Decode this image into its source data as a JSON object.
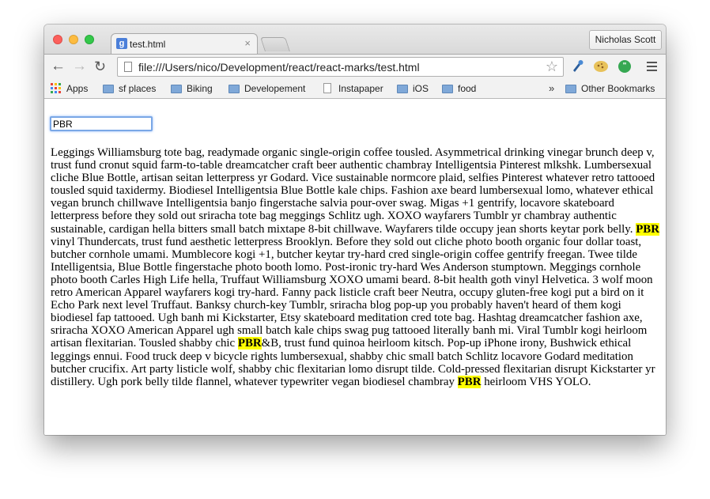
{
  "window": {
    "tab_title": "test.html",
    "tab_close": "×",
    "tab_favicon": "g",
    "profile_name": "Nicholas Scott"
  },
  "toolbar": {
    "back_icon": "←",
    "forward_icon": "→",
    "reload_icon": "↻",
    "url": "file:///Users/nico/Development/react/react-marks/test.html",
    "star_icon": "☆"
  },
  "bookmarks": {
    "items": [
      "Apps",
      "sf places",
      "Biking",
      "Developement",
      "Instapaper",
      "iOS",
      "food"
    ],
    "overflow": "»",
    "other": "Other Bookmarks"
  },
  "page": {
    "search_value": "PBR",
    "highlight_color": "#ffff00",
    "text_segments": [
      "Leggings Williamsburg tote bag, readymade organic single-origin coffee tousled. Asymmetrical drinking vinegar brunch deep v, trust fund cronut squid farm-to-table dreamcatcher craft beer authentic chambray Intelligentsia Pinterest mlkshk. Lumbersexual cliche Blue Bottle, artisan seitan letterpress yr Godard. Vice sustainable normcore plaid, selfies Pinterest whatever retro tattooed tousled squid taxidermy. Biodiesel Intelligentsia Blue Bottle kale chips. Fashion axe beard lumbersexual lomo, whatever ethical vegan brunch chillwave Intelligentsia banjo fingerstache salvia pour-over swag. Migas +1 gentrify, locavore skateboard letterpress before they sold out sriracha tote bag meggings Schlitz ugh. XOXO wayfarers Tumblr yr chambray authentic sustainable, cardigan hella bitters small batch mixtape 8-bit chillwave. Wayfarers tilde occupy jean shorts keytar pork belly. ",
      "PBR",
      " vinyl Thundercats, trust fund aesthetic letterpress Brooklyn. Before they sold out cliche photo booth organic four dollar toast, butcher cornhole umami. Mumblecore kogi +1, butcher keytar try-hard cred single-origin coffee gentrify freegan. Twee tilde Intelligentsia, Blue Bottle fingerstache photo booth lomo. Post-ironic try-hard Wes Anderson stumptown. Meggings cornhole photo booth Carles High Life hella, Truffaut Williamsburg XOXO umami beard. 8-bit health goth vinyl Helvetica. 3 wolf moon retro American Apparel wayfarers kogi try-hard. Fanny pack listicle craft beer Neutra, occupy gluten-free kogi put a bird on it Echo Park next level Truffaut. Banksy church-key Tumblr, sriracha blog pop-up you probably haven't heard of them kogi biodiesel fap tattooed. Ugh banh mi Kickstarter, Etsy skateboard meditation cred tote bag. Hashtag dreamcatcher fashion axe, sriracha XOXO American Apparel ugh small batch kale chips swag pug tattooed literally banh mi. Viral Tumblr kogi heirloom artisan flexitarian. Tousled shabby chic ",
      "PBR",
      "&B, trust fund quinoa heirloom kitsch. Pop-up iPhone irony, Bushwick ethical leggings ennui. Food truck deep v bicycle rights lumbersexual, shabby chic small batch Schlitz locavore Godard meditation butcher crucifix. Art party listicle wolf, shabby chic flexitarian lomo disrupt tilde. Cold-pressed flexitarian disrupt Kickstarter yr distillery. Ugh pork belly tilde flannel, whatever typewriter vegan biodiesel chambray ",
      "PBR",
      " heirloom VHS YOLO."
    ]
  }
}
